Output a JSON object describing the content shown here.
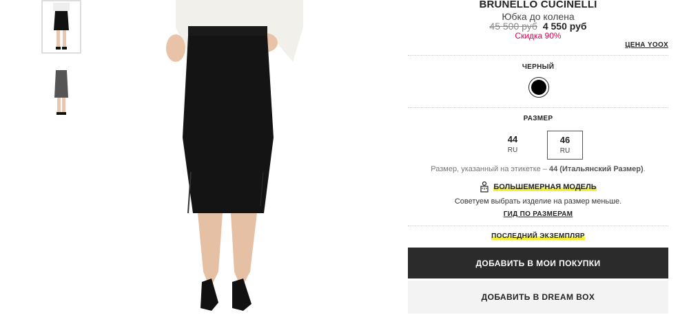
{
  "product": {
    "brand": "BRUNELLO CUCINELLI",
    "name": "Юбка до колена",
    "price_old": "45 500 руб",
    "price_new": "4 550 руб",
    "discount": "Скидка 90%",
    "yoox_price_label": "ЦЕНА YOOX"
  },
  "color": {
    "label": "ЧЕРНЫЙ",
    "swatch": "#000000"
  },
  "size": {
    "label": "РАЗМЕР",
    "options": [
      {
        "value": "44",
        "unit": "RU",
        "selected": false
      },
      {
        "value": "46",
        "unit": "RU",
        "selected": true
      }
    ],
    "note_prefix": "Размер, указанный на этикетке – ",
    "note_bold": "44 (Итальянский Размер)",
    "note_suffix": "."
  },
  "fit": {
    "icon": "ruler-person-icon",
    "label": "БОЛЬШЕМЕРНАЯ МОДЕЛЬ",
    "advice": "Советуем выбрать изделие на размер меньше.",
    "guide_link": "ГИД ПО РАЗМЕРАМ"
  },
  "stock": {
    "label": "ПОСЛЕДНИЙ ЭКЗЕМПЛЯР"
  },
  "actions": {
    "add_to_cart": "ДОБАВИТЬ В МОИ ПОКУПКИ",
    "add_to_dreambox": "ДОБАВИТЬ В DREAM BOX"
  },
  "colors": {
    "accent_discount": "#e0004d",
    "highlight": "#f5f03c",
    "primary_button": "#2b2b2b"
  }
}
